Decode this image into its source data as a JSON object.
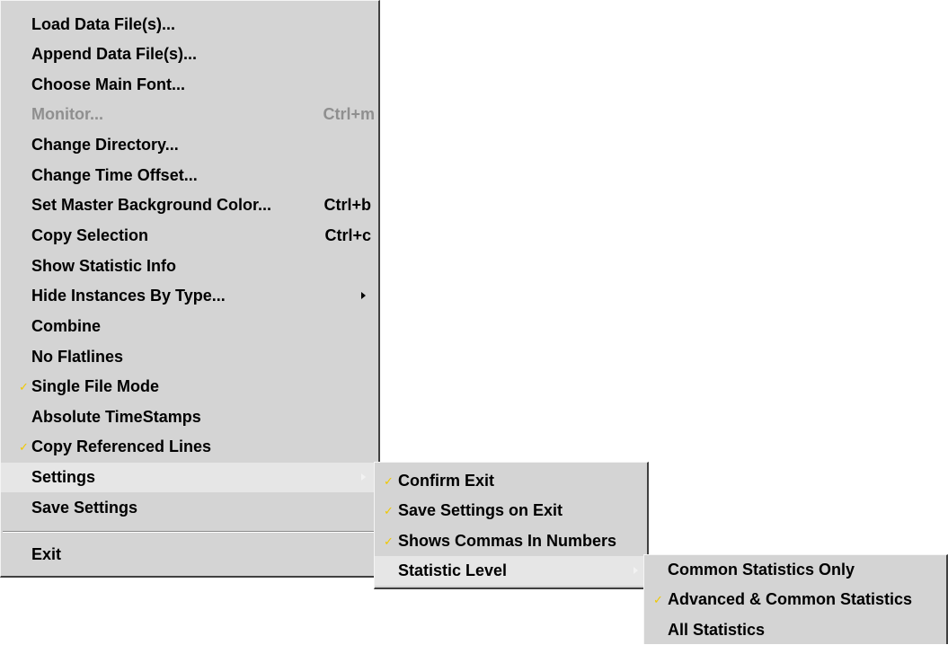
{
  "main_menu": {
    "items": [
      {
        "label": "Load Data File(s)..."
      },
      {
        "label": "Append Data File(s)..."
      },
      {
        "label": "Choose Main Font..."
      },
      {
        "label": "Monitor...",
        "shortcut": "Ctrl+m"
      },
      {
        "label": "Change Directory..."
      },
      {
        "label": "Change Time Offset..."
      },
      {
        "label": "Set Master Background Color...",
        "shortcut": "Ctrl+b"
      },
      {
        "label": "Copy Selection",
        "shortcut": "Ctrl+c"
      },
      {
        "label": "Show Statistic Info"
      },
      {
        "label": "Hide Instances By Type..."
      },
      {
        "label": "Combine"
      },
      {
        "label": "No Flatlines"
      },
      {
        "label": "Single File Mode"
      },
      {
        "label": "Absolute TimeStamps"
      },
      {
        "label": "Copy Referenced Lines"
      },
      {
        "label": "Settings"
      },
      {
        "label": "Save Settings"
      },
      {
        "label": "Exit"
      }
    ]
  },
  "settings_menu": {
    "items": [
      {
        "label": "Confirm Exit"
      },
      {
        "label": "Save Settings on Exit"
      },
      {
        "label": "Shows Commas In Numbers"
      },
      {
        "label": "Statistic Level"
      }
    ]
  },
  "statistic_level_menu": {
    "items": [
      {
        "label": "Common Statistics Only"
      },
      {
        "label": "Advanced & Common Statistics"
      },
      {
        "label": "All Statistics"
      }
    ]
  },
  "check_glyph": "✓",
  "colors": {
    "menu_bg": "#d4d4d4",
    "highlight": "#e6e6e6",
    "check": "#f0c800",
    "disabled": "#8f8f8f"
  }
}
